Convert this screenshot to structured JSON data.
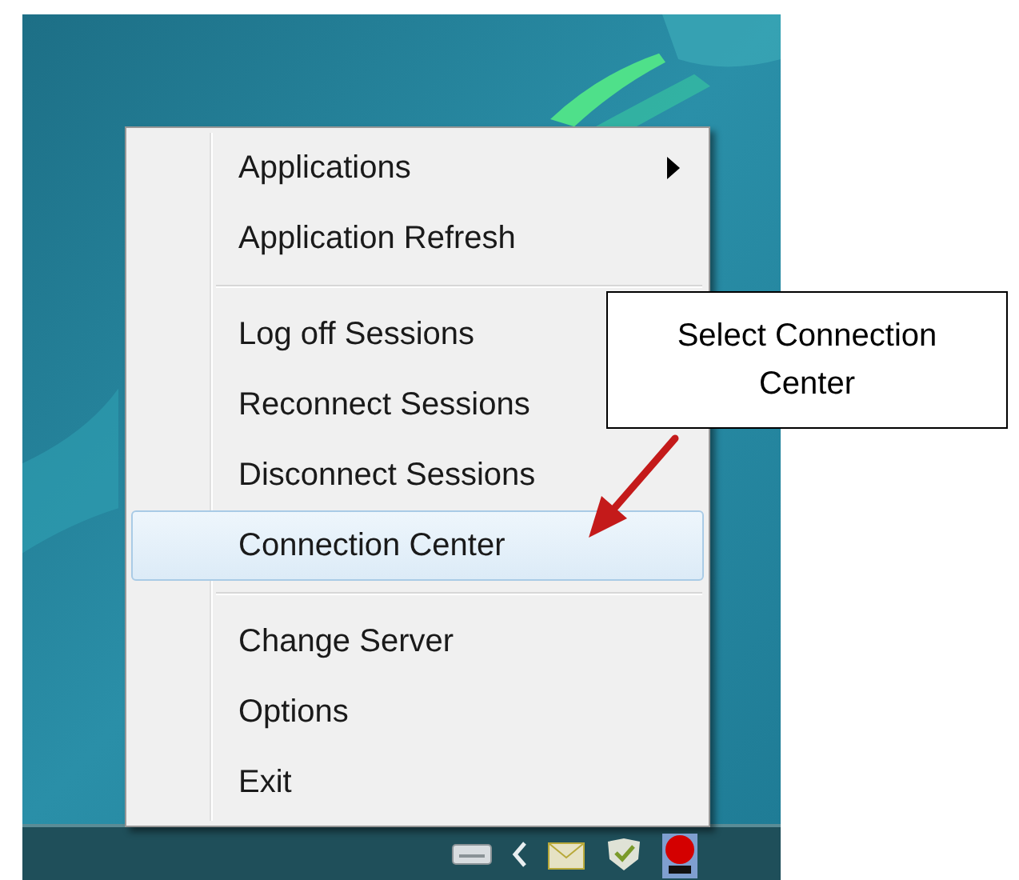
{
  "context_menu": {
    "items": [
      {
        "kind": "item",
        "label": "Applications",
        "submenu": true,
        "selected": false
      },
      {
        "kind": "item",
        "label": "Application Refresh",
        "submenu": false,
        "selected": false
      },
      {
        "kind": "separator"
      },
      {
        "kind": "item",
        "label": "Log off Sessions",
        "submenu": false,
        "selected": false
      },
      {
        "kind": "item",
        "label": "Reconnect Sessions",
        "submenu": false,
        "selected": false
      },
      {
        "kind": "item",
        "label": "Disconnect Sessions",
        "submenu": false,
        "selected": false
      },
      {
        "kind": "item",
        "label": "Connection Center",
        "submenu": false,
        "selected": true
      },
      {
        "kind": "separator"
      },
      {
        "kind": "item",
        "label": "Change Server",
        "submenu": false,
        "selected": false
      },
      {
        "kind": "item",
        "label": "Options",
        "submenu": false,
        "selected": false
      },
      {
        "kind": "item",
        "label": "Exit",
        "submenu": false,
        "selected": false
      }
    ]
  },
  "callout": {
    "text": "Select Connection Center"
  }
}
